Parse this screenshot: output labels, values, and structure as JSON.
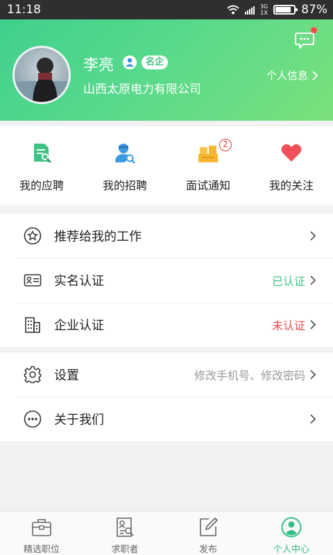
{
  "status_bar": {
    "time": "11:18",
    "network": "3G",
    "network_sub": "1X",
    "battery": "87%"
  },
  "profile": {
    "name": "李亮",
    "badge": "名企",
    "company": "山西太原电力有限公司",
    "info_link": "个人信息"
  },
  "quick_actions": [
    {
      "label": "我的应聘",
      "icon": "document-search-icon",
      "color": "#3fc383"
    },
    {
      "label": "我的招聘",
      "icon": "recruiter-icon",
      "color": "#3b9be0"
    },
    {
      "label": "面试通知",
      "icon": "interview-boxes-icon",
      "color": "#f5b731",
      "badge": "2"
    },
    {
      "label": "我的关注",
      "icon": "heart-icon",
      "color": "#f0505a"
    }
  ],
  "menu_group1": [
    {
      "label": "推荐给我的工作",
      "value": ""
    },
    {
      "label": "实名认证",
      "value": "已认证"
    },
    {
      "label": "企业认证",
      "value": "未认证"
    }
  ],
  "menu_group2": [
    {
      "label": "设置",
      "value": "修改手机号、修改密码"
    },
    {
      "label": "关于我们",
      "value": ""
    }
  ],
  "tabs": [
    {
      "label": "精选职位",
      "active": false
    },
    {
      "label": "求职者",
      "active": false
    },
    {
      "label": "发布",
      "active": false
    },
    {
      "label": "个人中心",
      "active": true
    }
  ],
  "colors": {
    "accent": "#3fc383",
    "verified": "#3fc383",
    "unverified": "#e84d4d"
  }
}
